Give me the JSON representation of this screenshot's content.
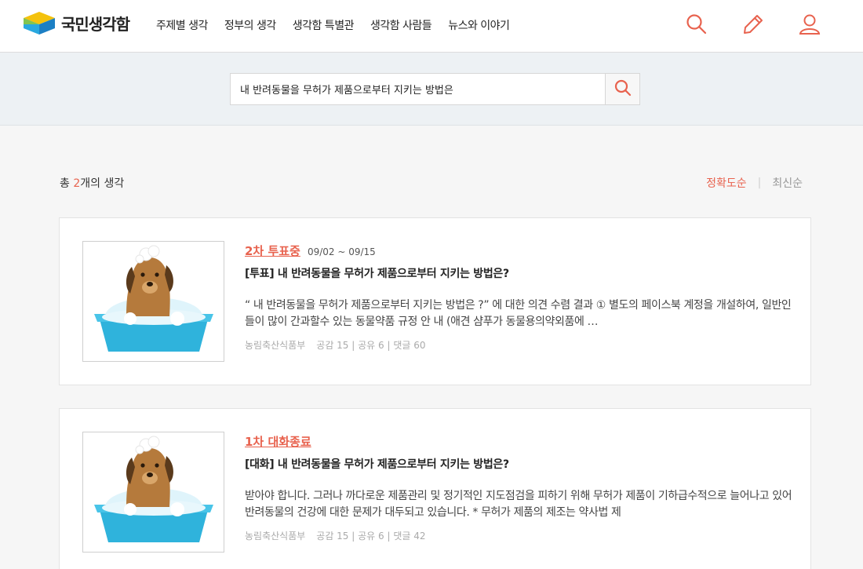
{
  "brand": {
    "name": "국민생각함",
    "accent": "#e8624e"
  },
  "nav": [
    "주제별 생각",
    "정부의 생각",
    "생각함 특별관",
    "생각함 사람들",
    "뉴스와 이야기"
  ],
  "header_icons": [
    "search-icon",
    "pencil-icon",
    "user-icon"
  ],
  "search": {
    "value": "내 반려동물을 무허가 제품으로부터 지키는 방법은",
    "button_icon": "search-icon"
  },
  "results": {
    "total_prefix": "총 ",
    "total_count": "2",
    "total_suffix": "개의 생각",
    "sort_active": "정확도순",
    "sort_other": "최신순"
  },
  "cards": [
    {
      "status": "2차 투표중",
      "dates": "09/02 ~ 09/15",
      "title": "[투표] 내 반려동물을 무허가 제품으로부터 지키는 방법은?",
      "excerpt": "“ 내 반려동물을 무허가 제품으로부터 지키는 방법은 ?” 에 대한 의견 수렴 결과 ① 별도의 페이스북 계정을 개설하여, 일반인들이 많이 간과할수 있는 동물약품 규정 안 내 (애견 샴푸가 동물용의약외품에 …",
      "dept": "농림축산식품부",
      "stats": "공감 15 | 공유 6 | 댓글 60"
    },
    {
      "status": "1차 대화종료",
      "dates": "",
      "title": "[대화] 내 반려동물을 무허가 제품으로부터 지키는 방법은?",
      "excerpt": "받아야 합니다. 그러나 까다로운 제품관리 및 정기적인 지도점검을 피하기 위해 무허가 제품이 기하급수적으로 늘어나고 있어 반려동물의 건강에 대한 문제가 대두되고 있습니다. * 무허가 제품의 제조는 약사법 제",
      "dept": "농림축산식품부",
      "stats": "공감 15 | 공유 6 | 댓글 42"
    }
  ]
}
